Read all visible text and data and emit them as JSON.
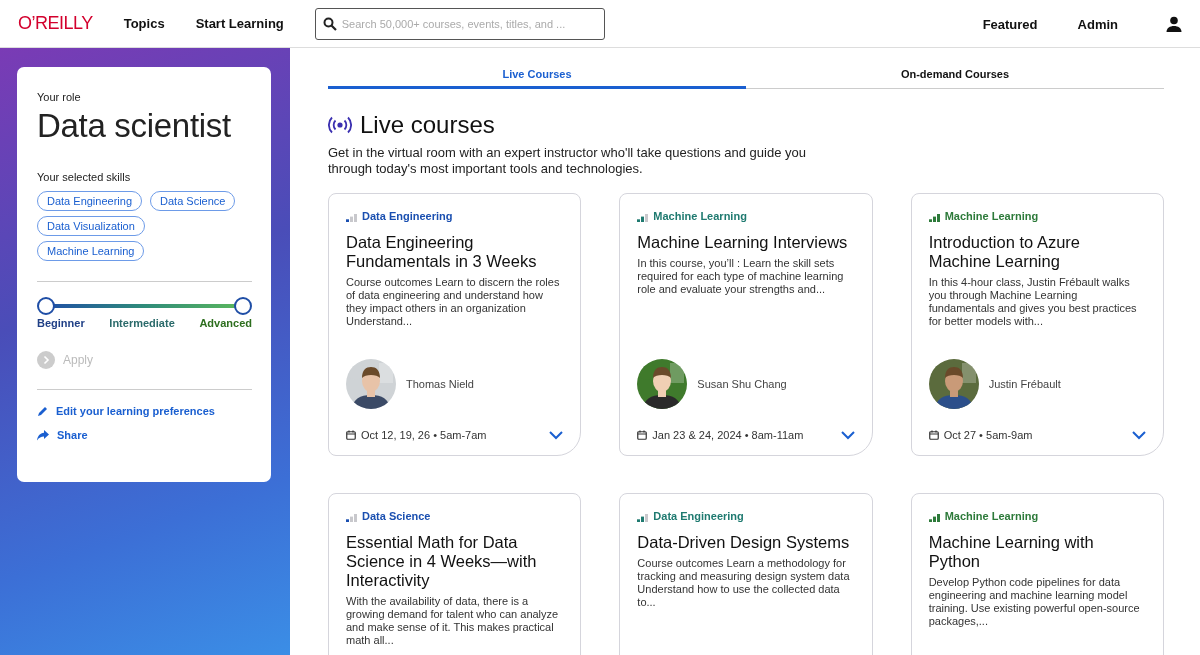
{
  "header": {
    "logo": "O’REILLY",
    "nav": [
      "Topics",
      "Start Learning"
    ],
    "search": {
      "placeholder": "Search 50,000+ courses, events, titles, and ..."
    },
    "right_nav": [
      "Featured",
      "Admin"
    ]
  },
  "sidebar": {
    "role_label": "Your role",
    "role": "Data scientist",
    "skills_label": "Your selected skills",
    "skills": [
      "Data Engineering",
      "Data Science",
      "Data Visualization",
      "Machine Learning"
    ],
    "range_labels": [
      "Beginner",
      "Intermediate",
      "Advanced"
    ],
    "apply": {
      "label": "Apply",
      "disabled": true
    },
    "links": [
      {
        "kind": "edit",
        "label": "Edit your learning preferences"
      },
      {
        "kind": "share",
        "label": "Share"
      }
    ]
  },
  "tabs": [
    {
      "label": "Live Courses",
      "selected": true
    },
    {
      "label": "On-demand Courses",
      "selected": false
    }
  ],
  "section": {
    "title": "Live courses",
    "description": "Get in the virtual room with an expert instructor who'll take questions and guide you through today's most important tools and technologies."
  },
  "courses": [
    {
      "topic": "Data Engineering",
      "kind": "beginner",
      "title": "Data Engineering Fundamentals in 3 Weeks",
      "description": "Course outcomes Learn to discern the roles of data engineering and understand how they impact others in an organization Understand...",
      "instructor": "Thomas Nield",
      "date": "Oct 12, 19, 26 • 5am-7am"
    },
    {
      "topic": "Machine Learning",
      "kind": "intermediate",
      "title": "Machine Learning Interviews",
      "description": "In this course, you’ll : Learn the skill sets required for each type of machine learning role and evaluate your strengths and...",
      "instructor": "Susan Shu Chang",
      "date": "Jan 23 & 24, 2024 • 8am-11am"
    },
    {
      "topic": "Machine Learning",
      "kind": "advanced",
      "title": "Introduction to Azure Machine Learning",
      "description": "In this 4-hour class, Justin Frébault walks you through Machine Learning fundamentals and gives you best practices for better models with...",
      "instructor": "Justin Frébault",
      "date": "Oct 27 • 5am-9am"
    },
    {
      "topic": "Data Science",
      "kind": "beginner",
      "title": "Essential Math for Data Science in 4 Weeks—with Interactivity",
      "description": "With the availability of data, there is a growing demand for talent who can analyze and make sense of it. This makes practical math all..."
    },
    {
      "topic": "Data Engineering",
      "kind": "intermediate",
      "title": "Data-Driven Design Systems",
      "description": "Course outcomes Learn a methodology for tracking and measuring design system data Understand how to use the collected data to..."
    },
    {
      "topic": "Machine Learning",
      "kind": "advanced",
      "title": "Machine Learning with Python",
      "description": "Develop Python code pipelines for data engineering and machine learning model training. Use existing powerful open-source packages,..."
    }
  ]
}
